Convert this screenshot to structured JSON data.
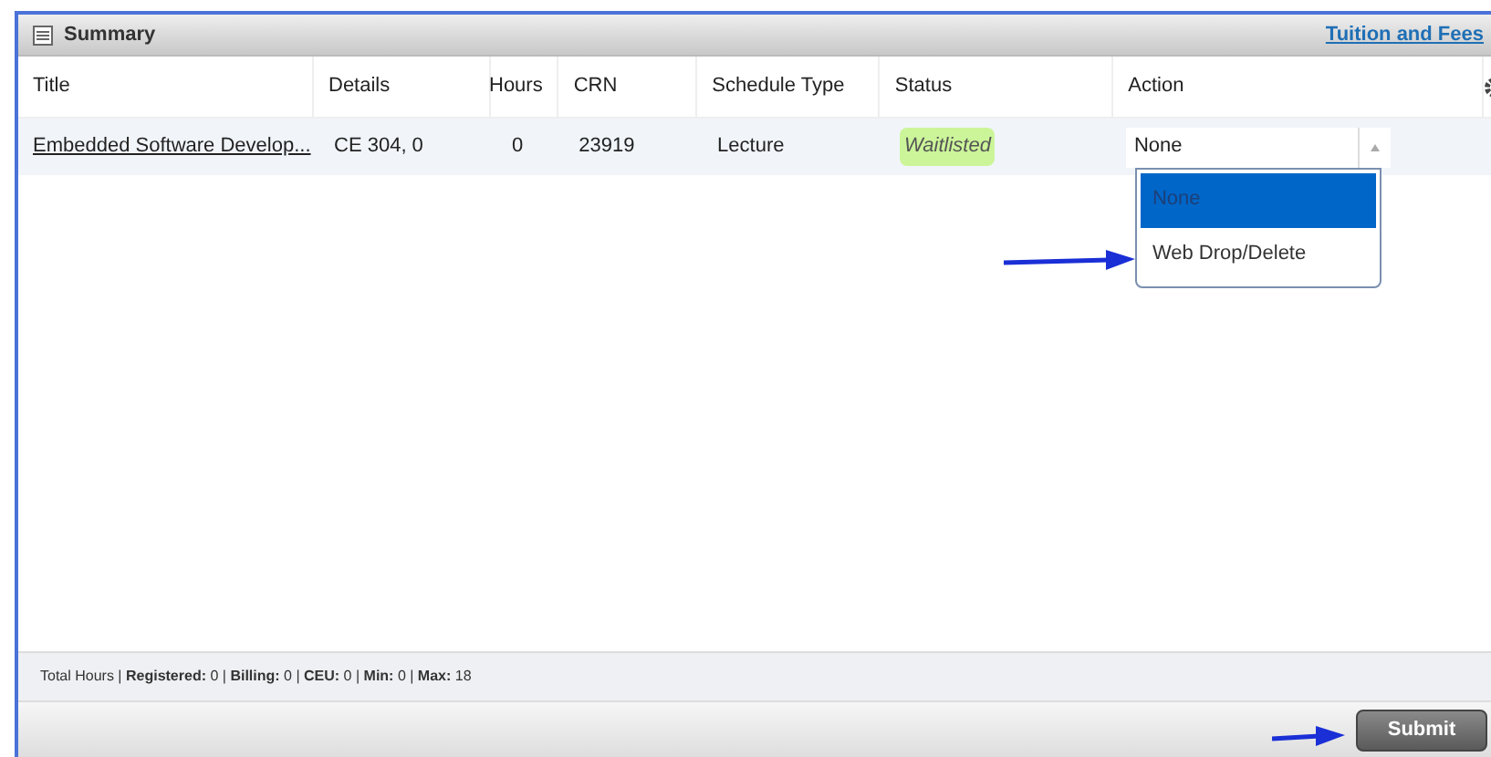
{
  "panel": {
    "title": "Summary",
    "link": "Tuition and Fees"
  },
  "table": {
    "columns": [
      "Title",
      "Details",
      "Hours",
      "CRN",
      "Schedule Type",
      "Status",
      "Action"
    ],
    "rows": [
      {
        "title": "Embedded Software Develop...",
        "details": "CE 304, 0",
        "hours": "0",
        "crn": "23919",
        "schedule_type": "Lecture",
        "status": "Waitlisted",
        "action": "None",
        "dropdown_open": true
      }
    ]
  },
  "dropdown": {
    "options": [
      {
        "label": "None",
        "selected": true
      },
      {
        "label": "Web Drop/Delete",
        "selected": false
      }
    ]
  },
  "footer": "Total Hours | **Registered:** 0 | **Billing:** 0 | **CEU:** 0 | **Min:** 0 | **Max:** 18",
  "buttons": [
    "Submit"
  ]
}
